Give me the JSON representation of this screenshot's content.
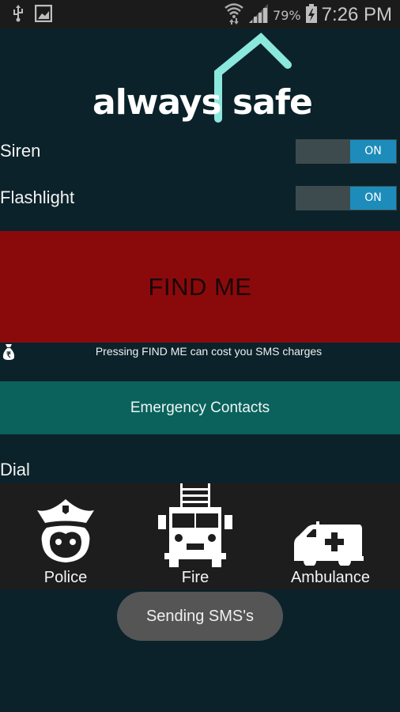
{
  "status_bar": {
    "left_icons": [
      "usb-icon",
      "image-notification-icon"
    ],
    "right_icons": [
      "wifi-icon",
      "signal-icon",
      "battery-charging-icon"
    ],
    "battery_percent": "79%",
    "time": "7:26 PM"
  },
  "app": {
    "logo_text_left": "always",
    "logo_text_right": "safe",
    "brand_color": "#8be8dc"
  },
  "settings": {
    "siren": {
      "label": "Siren",
      "toggle_label": "ON",
      "enabled": true
    },
    "flashlight": {
      "label": "Flashlight",
      "toggle_label": "ON",
      "enabled": true
    }
  },
  "find_me": {
    "label": "FIND ME",
    "color": "#8a0a0c",
    "warning_icon": "money-bag-rupee-icon",
    "warning_text": "Pressing FIND ME can cost you SMS charges"
  },
  "emergency_contacts": {
    "label": "Emergency Contacts",
    "color": "#0b625c"
  },
  "dial": {
    "heading": "Dial",
    "items": [
      {
        "label": "Police",
        "icon": "police-officer-icon"
      },
      {
        "label": "Fire",
        "icon": "fire-truck-icon"
      },
      {
        "label": "Ambulance",
        "icon": "ambulance-icon"
      }
    ]
  },
  "toast": {
    "text": "Sending SMS's"
  }
}
